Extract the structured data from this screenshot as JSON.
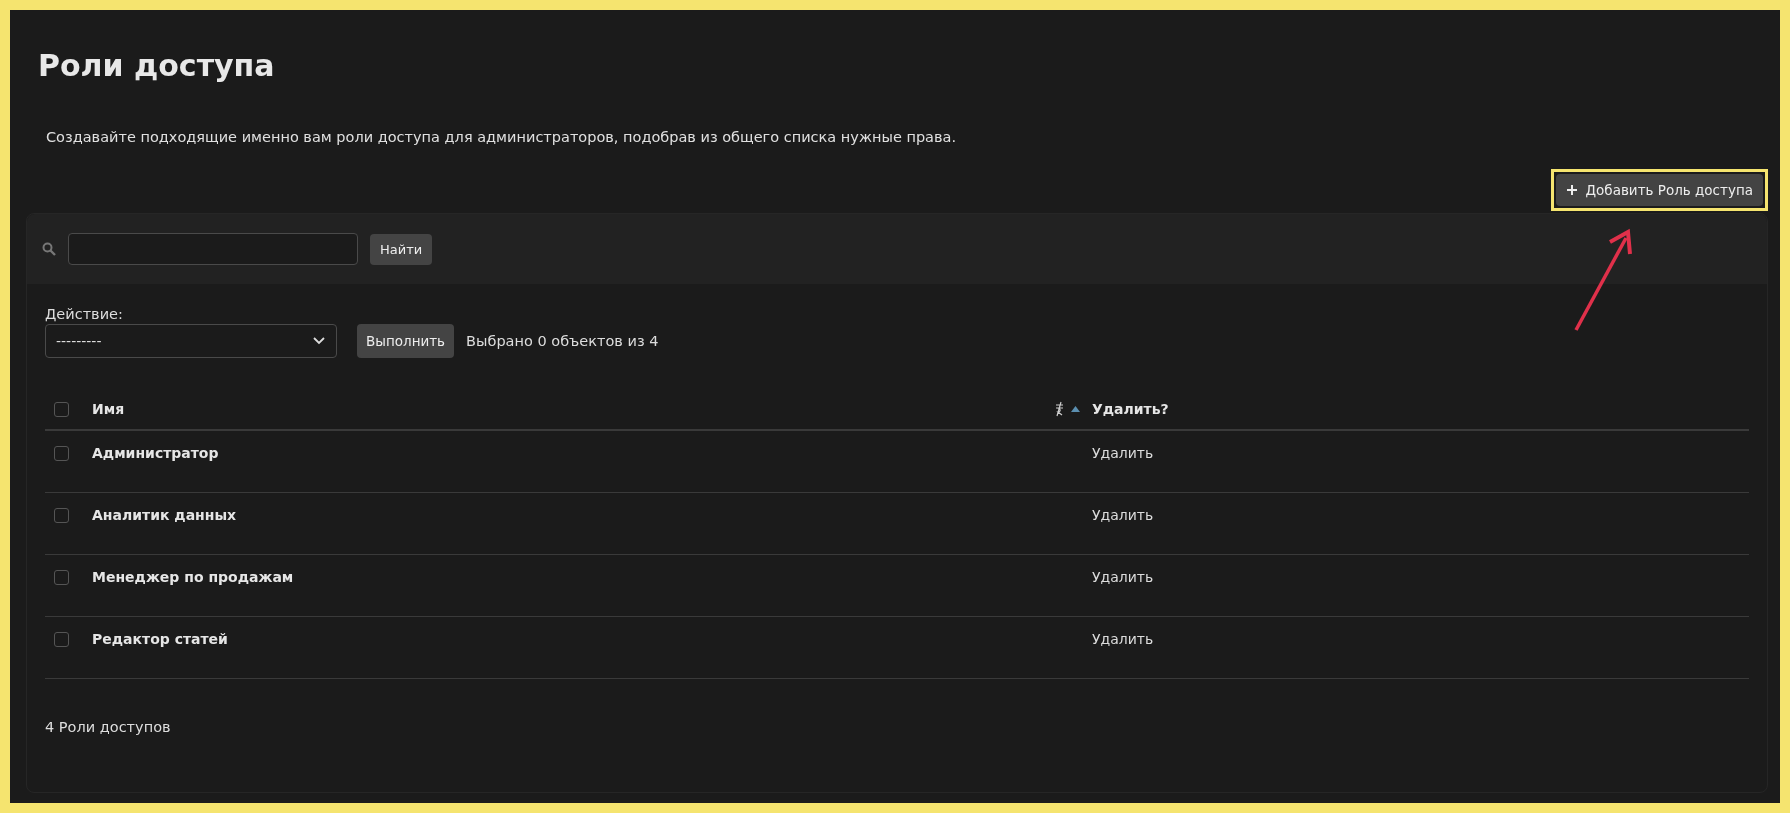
{
  "page": {
    "title": "Роли доступа",
    "description": "Создавайте подходящие именно вам роли доступа для администраторов, подобрав из общего списка нужные права.",
    "add_button": "Добавить Роль доступа"
  },
  "search": {
    "button": "Найти"
  },
  "actions": {
    "label": "Действие:",
    "value": "---------",
    "run_button": "Выполнить",
    "selection_text": "Выбрано 0 объектов из 4"
  },
  "table": {
    "select_all_checked": false,
    "columns": [
      {
        "label": "Имя",
        "sorted": true
      },
      {
        "label": "Удалить?",
        "sorted": false
      }
    ],
    "rows": [
      {
        "name": "Администратор",
        "delete": "Удалить",
        "checked": false
      },
      {
        "name": "Аналитик данных",
        "delete": "Удалить",
        "checked": false
      },
      {
        "name": "Менеджер по продажам",
        "delete": "Удалить",
        "checked": false
      },
      {
        "name": "Редактор статей",
        "delete": "Удалить",
        "checked": false
      }
    ]
  },
  "footer": "4 Роли доступов"
}
